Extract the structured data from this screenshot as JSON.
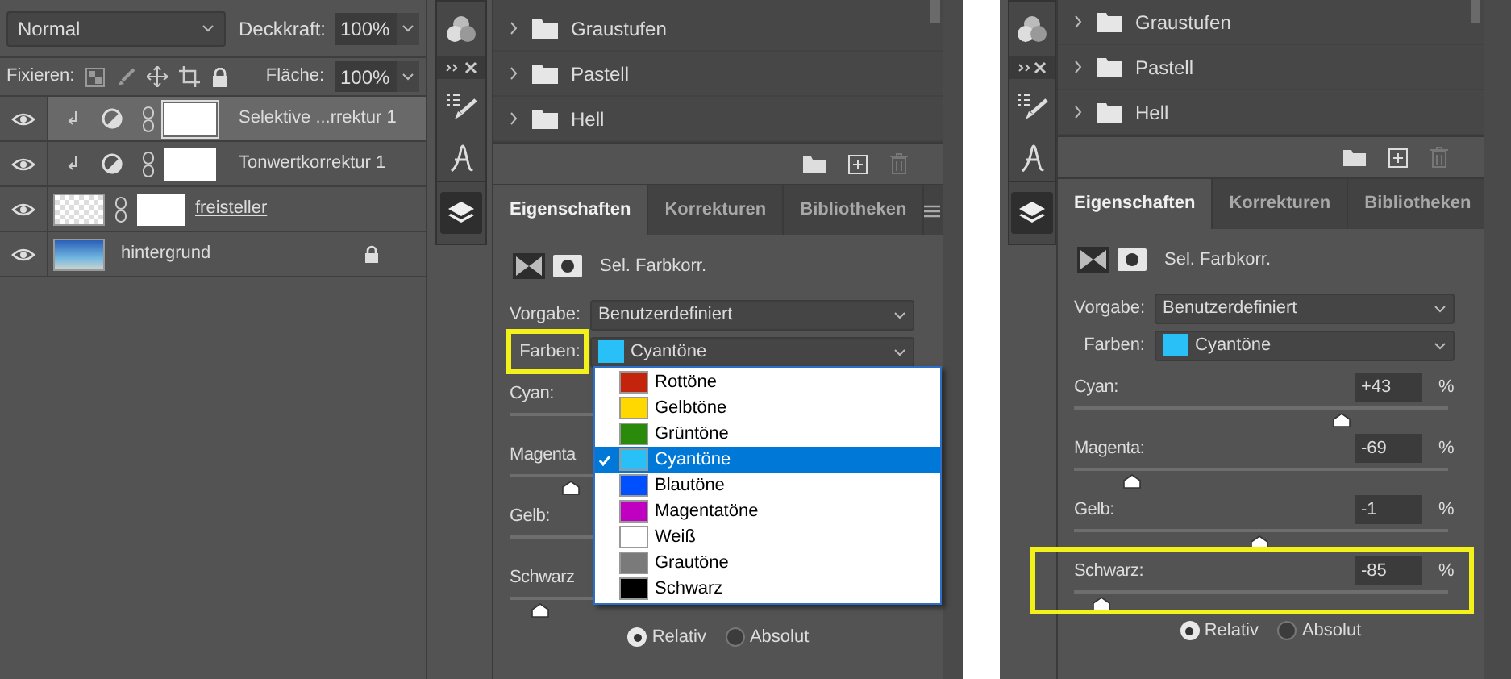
{
  "layers_panel": {
    "blend_mode": "Normal",
    "opacity_label": "Deckkraft:",
    "opacity": "100%",
    "lock_label": "Fixieren:",
    "fill_label": "Fläche:",
    "fill": "100%",
    "layers": [
      {
        "name": "Selektive ...rrektur 1",
        "kind": "adjustment",
        "selected": true
      },
      {
        "name": "Tonwertkorrektur 1",
        "kind": "adjustment",
        "selected": false
      },
      {
        "name": "freisteller",
        "kind": "masked",
        "selected": false
      },
      {
        "name": "hintergrund",
        "kind": "background",
        "selected": false,
        "locked": true
      }
    ]
  },
  "properties_panels": [
    {
      "folders": [
        "Graustufen",
        "Pastell",
        "Hell"
      ],
      "tabs": [
        {
          "label": "Eigenschaften",
          "selected": true
        },
        {
          "label": "Korrekturen",
          "selected": false
        },
        {
          "label": "Bibliotheken",
          "selected": false
        }
      ],
      "adjustment": "Sel. Farbkorr.",
      "preset_label": "Vorgabe:",
      "preset": "Benutzerdefiniert",
      "colors_label": "Farben:",
      "colors_label_highlighted": true,
      "colors": "Cyantöne",
      "color_menu": [
        {
          "label": "Rottöne",
          "color": "#c4240c",
          "selected": false
        },
        {
          "label": "Gelbtöne",
          "color": "#ffd800",
          "selected": false
        },
        {
          "label": "Grüntöne",
          "color": "#2a8a0c",
          "selected": false
        },
        {
          "label": "Cyantöne",
          "color": "#29c0f7",
          "selected": true
        },
        {
          "label": "Blautöne",
          "color": "#0050ff",
          "selected": false
        },
        {
          "label": "Magentatöne",
          "color": "#c000c0",
          "selected": false
        },
        {
          "label": "Weiß",
          "color": "#ffffff",
          "selected": false
        },
        {
          "label": "Grautöne",
          "color": "#7a7a7a",
          "selected": false
        },
        {
          "label": "Schwarz",
          "color": "#000000",
          "selected": false
        }
      ],
      "sliders": [
        {
          "label": "Cyan:"
        },
        {
          "label": "Magenta",
          "level": 0.155
        },
        {
          "label": "Gelb:"
        },
        {
          "label": "Schwarz",
          "level": 0.075
        }
      ],
      "modes": [
        {
          "label": "Relativ",
          "selected": true
        },
        {
          "label": "Absolut",
          "selected": false
        }
      ]
    },
    {
      "folders": [
        "Graustufen",
        "Pastell",
        "Hell"
      ],
      "tabs": [
        {
          "label": "Eigenschaften",
          "selected": true
        },
        {
          "label": "Korrekturen",
          "selected": false
        },
        {
          "label": "Bibliotheken",
          "selected": false
        }
      ],
      "adjustment": "Sel. Farbkorr.",
      "preset_label": "Vorgabe:",
      "preset": "Benutzerdefiniert",
      "colors_label": "Farben:",
      "colors_label_highlighted": false,
      "colors": "Cyantöne",
      "sliders": [
        {
          "label": "Cyan:",
          "value": "+43",
          "unit": "%",
          "level": 0.715,
          "highlighted": false
        },
        {
          "label": "Magenta:",
          "value": "-69",
          "unit": "%",
          "level": 0.155,
          "highlighted": false
        },
        {
          "label": "Gelb:",
          "value": "-1",
          "unit": "%",
          "level": 0.495,
          "highlighted": false
        },
        {
          "label": "Schwarz:",
          "value": "-85",
          "unit": "%",
          "level": 0.075,
          "highlighted": true
        }
      ],
      "modes": [
        {
          "label": "Relativ",
          "selected": true
        },
        {
          "label": "Absolut",
          "selected": false
        }
      ]
    }
  ]
}
